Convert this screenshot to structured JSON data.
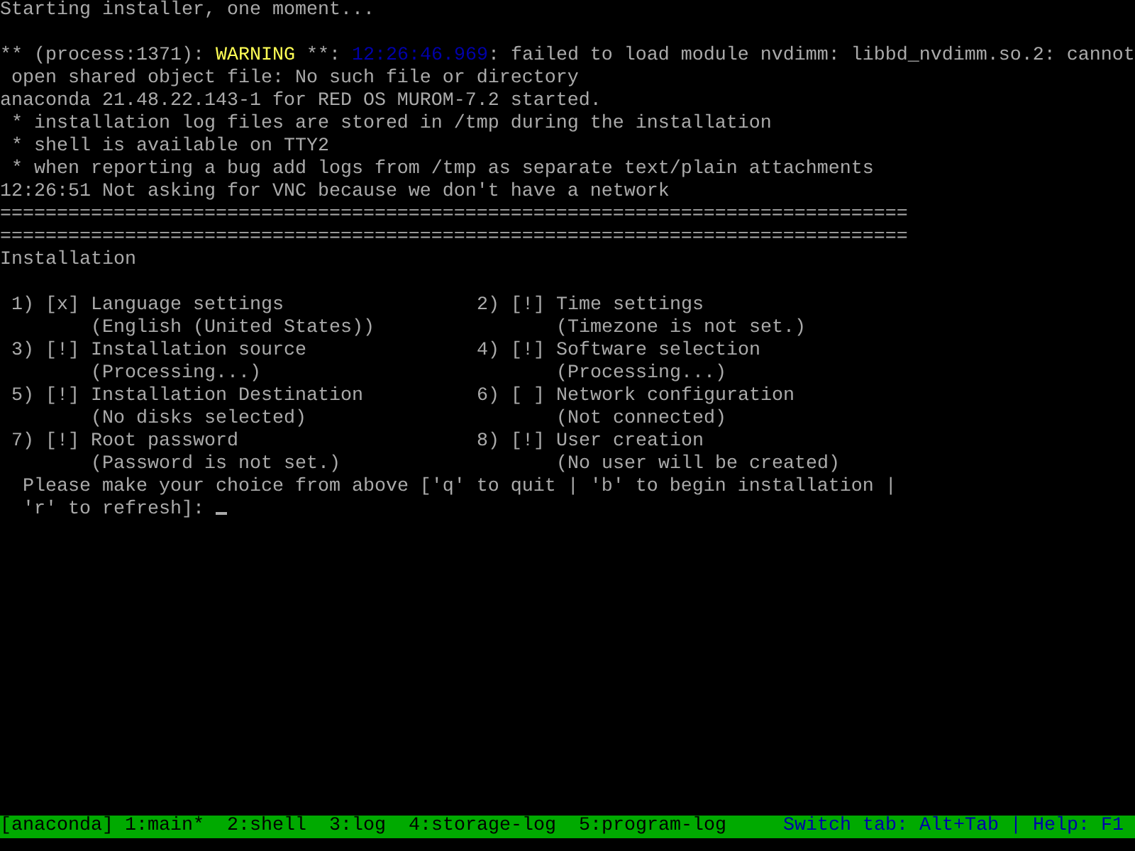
{
  "header": "Starting installer, one moment...",
  "log_lines": [
    [
      {
        "kind": "plain",
        "text": "** (process:1371): "
      },
      {
        "kind": "warning",
        "text": "WARNING"
      },
      {
        "kind": "plain",
        "text": " **: "
      },
      {
        "kind": "timestamp",
        "text": "12:26:46.969"
      },
      {
        "kind": "plain",
        "text": ": failed to load module nvdimm: libbd_nvdimm.so.2: cannot"
      }
    ],
    [
      {
        "kind": "plain",
        "text": " open shared object file: No such file or directory"
      }
    ],
    [
      {
        "kind": "plain",
        "text": "anaconda 21.48.22.143-1 for RED OS MUROM-7.2 started."
      }
    ],
    [
      {
        "kind": "plain",
        "text": " * installation log files are stored in /tmp during the installation"
      }
    ],
    [
      {
        "kind": "plain",
        "text": " * shell is available on TTY2"
      }
    ],
    [
      {
        "kind": "plain",
        "text": " * when reporting a bug add logs from /tmp as separate text/plain attachments"
      }
    ],
    [
      {
        "kind": "plain",
        "text": "12:26:51 Not asking for VNC because we don't have a network"
      }
    ],
    [
      {
        "kind": "plain",
        "text": "================================================================================"
      }
    ],
    [
      {
        "kind": "plain",
        "text": "================================================================================"
      }
    ],
    [
      {
        "kind": "plain",
        "text": "Installation"
      }
    ]
  ],
  "menu": [
    {
      "number": "1)",
      "status": "[x]",
      "title": "Language settings",
      "detail": "(English (United States))"
    },
    {
      "number": "2)",
      "status": "[!]",
      "title": "Time settings",
      "detail": "(Timezone is not set.)"
    },
    {
      "number": "3)",
      "status": "[!]",
      "title": "Installation source",
      "detail": "(Processing...)"
    },
    {
      "number": "4)",
      "status": "[!]",
      "title": "Software selection",
      "detail": "(Processing...)"
    },
    {
      "number": "5)",
      "status": "[!]",
      "title": "Installation Destination",
      "detail": "(No disks selected)"
    },
    {
      "number": "6)",
      "status": "[ ]",
      "title": "Network configuration",
      "detail": "(Not connected)"
    },
    {
      "number": "7)",
      "status": "[!]",
      "title": "Root password",
      "detail": "(Password is not set.)"
    },
    {
      "number": "8)",
      "status": "[!]",
      "title": "User creation",
      "detail": "(No user will be created)"
    }
  ],
  "prompt_lines": [
    "Please make your choice from above ['q' to quit | 'b' to begin installation |",
    "'r' to refresh]: "
  ],
  "status_bar": {
    "session": "[anaconda]",
    "tabs": [
      "1:main*",
      "2:shell",
      "3:log",
      "4:storage-log",
      "5:program-log"
    ],
    "hint": "Switch tab: Alt+Tab | Help: F1"
  }
}
